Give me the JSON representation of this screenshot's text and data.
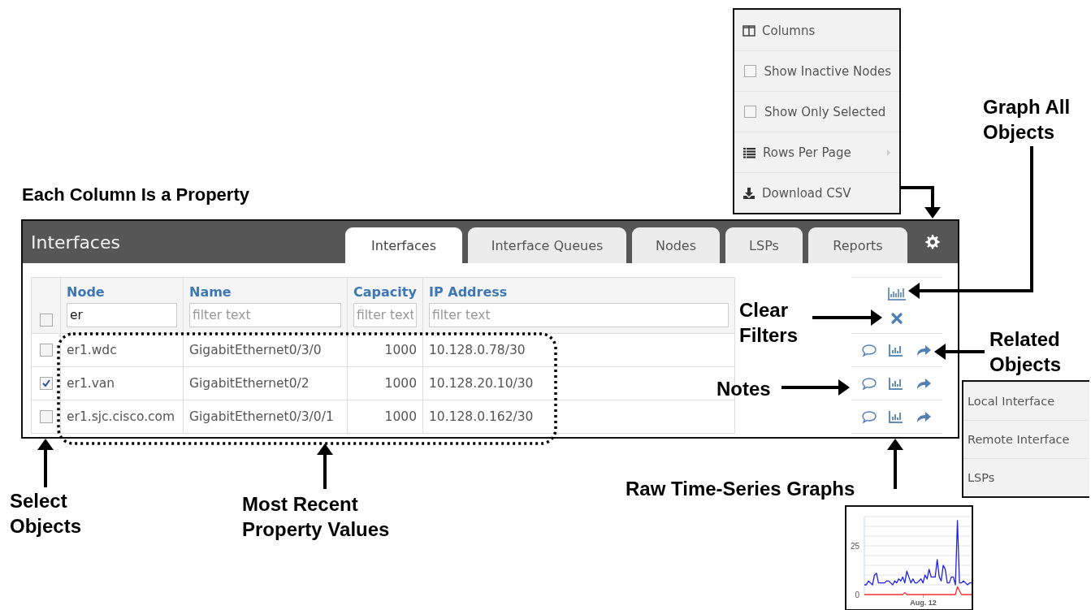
{
  "columns_menu": {
    "items": [
      {
        "kind": "columns",
        "label": "Columns"
      },
      {
        "kind": "checkbox",
        "label": "Show Inactive Nodes",
        "checked": false
      },
      {
        "kind": "checkbox",
        "label": "Show Only Selected",
        "checked": false
      },
      {
        "kind": "rows",
        "label": "Rows Per Page"
      },
      {
        "kind": "download",
        "label": "Download CSV"
      }
    ]
  },
  "panel": {
    "title": "Interfaces",
    "tabs": [
      {
        "label": "Interfaces",
        "selected": true
      },
      {
        "label": "Interface Queues",
        "selected": false
      },
      {
        "label": "Nodes",
        "selected": false
      },
      {
        "label": "LSPs",
        "selected": false
      },
      {
        "label": "Reports",
        "selected": false
      }
    ],
    "table": {
      "select_all": {
        "checked": false
      },
      "columns": [
        {
          "label": "Node",
          "filter_value": "er"
        },
        {
          "label": "Name",
          "placeholder": "filter text"
        },
        {
          "label": "Capacity",
          "placeholder": "filter text"
        },
        {
          "label": "IP Address",
          "placeholder": "filter text"
        }
      ],
      "rows": [
        {
          "selected": false,
          "cells": [
            "er1.wdc",
            "GigabitEthernet0/3/0",
            "1000",
            "10.128.0.78/30"
          ]
        },
        {
          "selected": true,
          "cells": [
            "er1.van",
            "GigabitEthernet0/2",
            "1000",
            "10.128.20.10/30"
          ]
        },
        {
          "selected": false,
          "cells": [
            "er1.sjc.cisco.com",
            "GigabitEthernet0/3/0/1",
            "1000",
            "10.128.0.162/30"
          ]
        }
      ]
    }
  },
  "related_menu": {
    "items": [
      "Local Interface",
      "Remote Interface",
      "LSPs"
    ]
  },
  "graph": {
    "chart_data": {
      "type": "line",
      "yticks": [
        {
          "value": 0,
          "label": "0"
        },
        {
          "value": 25,
          "label": "25"
        }
      ],
      "ylim": [
        0,
        40
      ],
      "annotations": [
        "Aug. 12"
      ],
      "series": [
        {
          "color": "#2020ee",
          "values": [
            5,
            5,
            7,
            6,
            5,
            10,
            11,
            6,
            6,
            6,
            6,
            7,
            7,
            6,
            5,
            7,
            6,
            8,
            7,
            9,
            6,
            12,
            9,
            6,
            8,
            6,
            6,
            7,
            8,
            6,
            10,
            8,
            13,
            9,
            9,
            9,
            18,
            9,
            7,
            15,
            13,
            6,
            6,
            9,
            9,
            5,
            38,
            6,
            6,
            7,
            6,
            5,
            6,
            6
          ]
        },
        {
          "color": "#ee3030",
          "values": [
            0,
            0,
            0,
            0,
            0,
            0,
            0,
            0,
            0,
            0,
            0,
            0,
            0,
            0,
            0,
            0,
            0,
            0,
            0,
            0,
            1,
            0,
            0,
            0,
            0,
            0,
            0,
            0,
            0,
            0,
            0,
            0,
            0,
            0,
            0,
            0,
            0,
            0,
            0,
            0,
            0,
            0,
            0,
            0,
            0,
            0,
            4,
            2,
            0,
            0,
            0,
            0,
            0,
            0
          ]
        }
      ]
    }
  },
  "callouts": [
    "Each Column Is a Property",
    "Graph All Objects",
    "Clear Filters",
    "Related Objects",
    "Notes",
    "Select Objects",
    "Most Recent Property Values",
    "Raw Time-Series Graphs"
  ]
}
